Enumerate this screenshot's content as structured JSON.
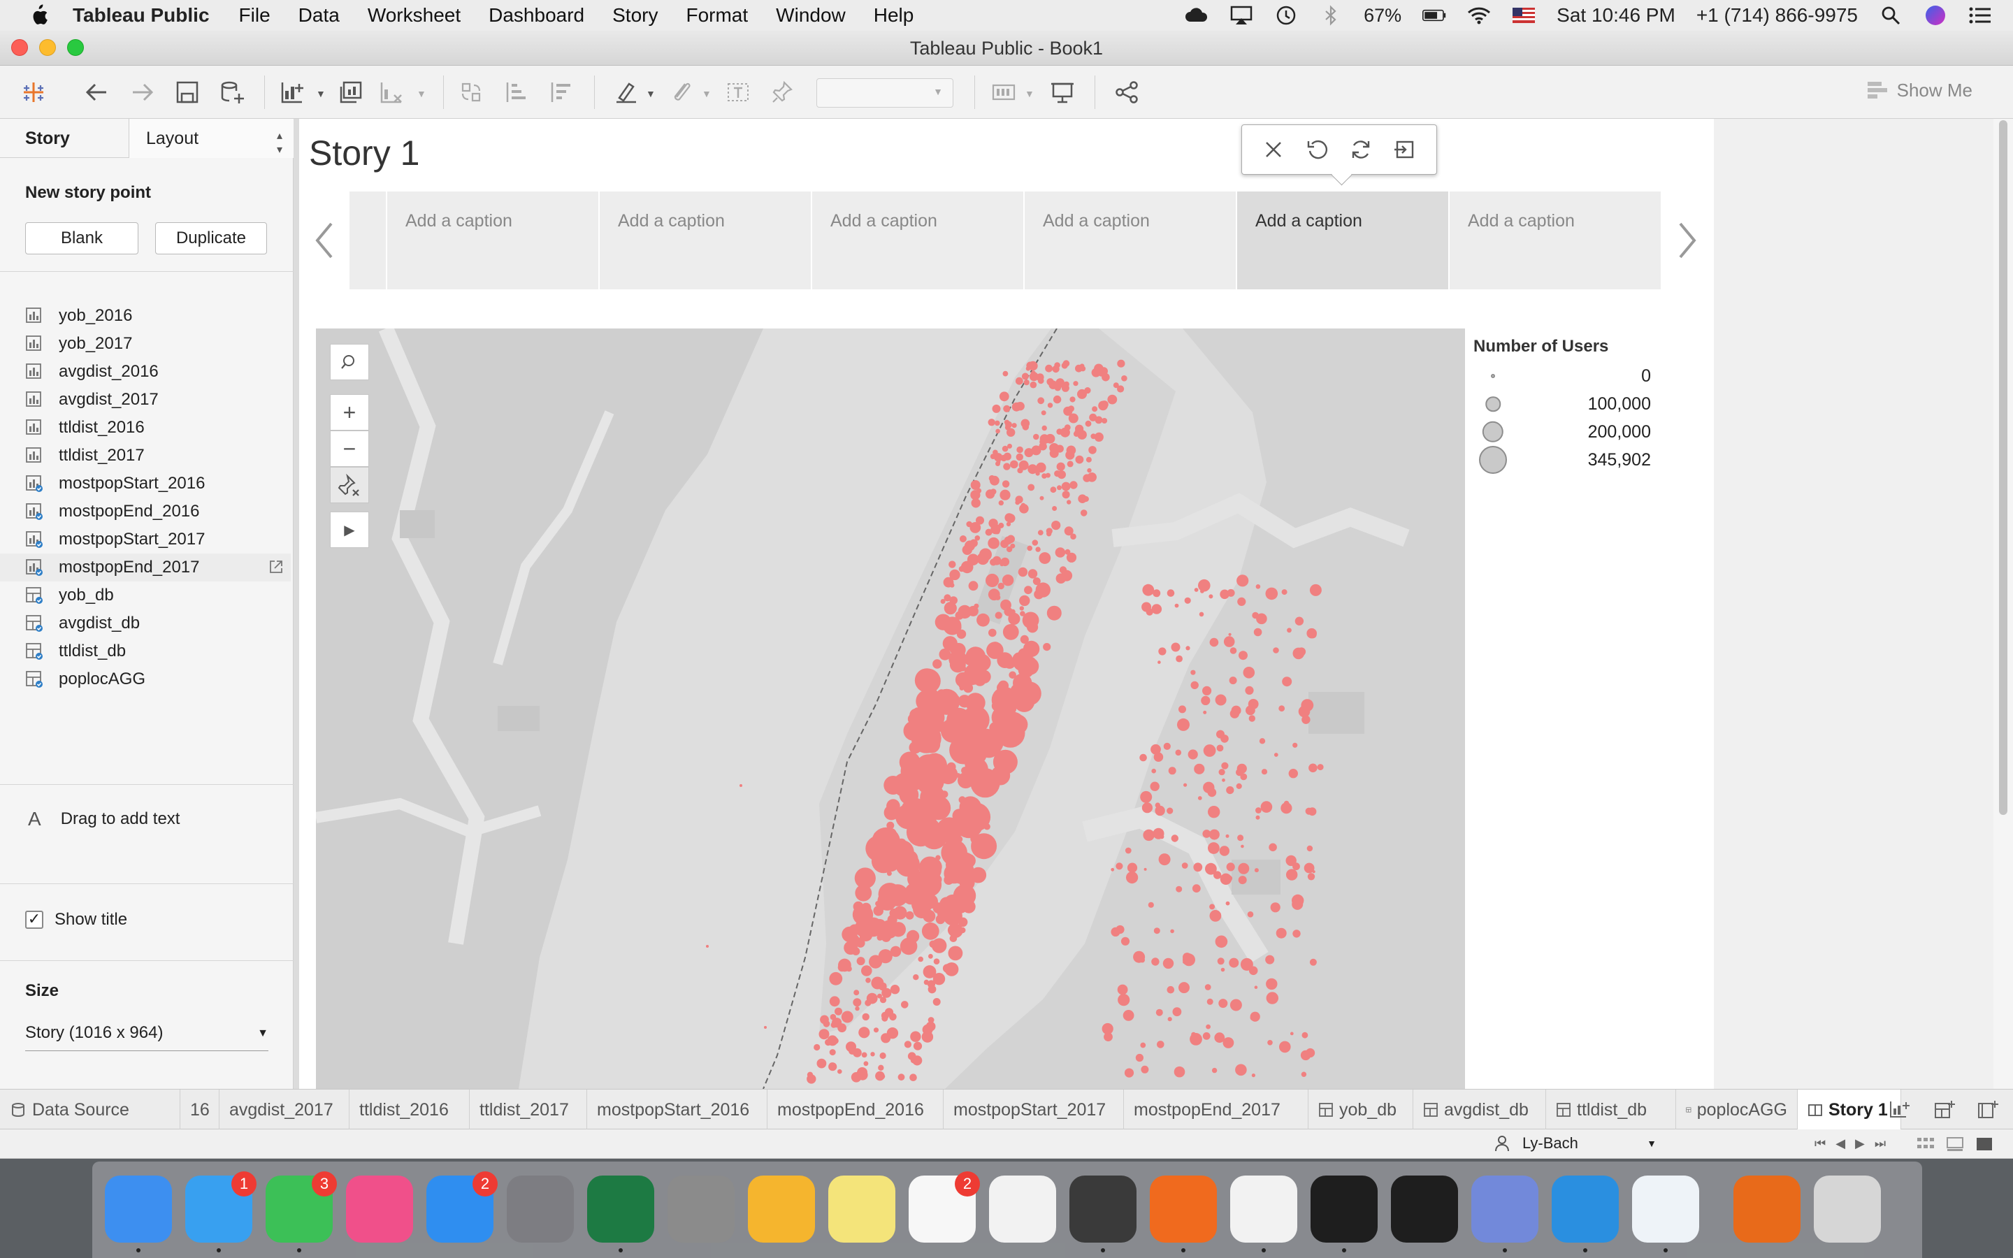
{
  "menubar": {
    "app_name": "Tableau Public",
    "items": [
      "File",
      "Data",
      "Worksheet",
      "Dashboard",
      "Story",
      "Format",
      "Window",
      "Help"
    ],
    "battery": "67%",
    "datetime": "Sat 10:46 PM",
    "phone": "+1 (714) 866-9975"
  },
  "window": {
    "title": "Tableau Public - Book1"
  },
  "toolbar": {
    "show_me": "Show Me"
  },
  "left_panel": {
    "tab_story": "Story",
    "tab_layout": "Layout",
    "new_story_point": "New story point",
    "blank_label": "Blank",
    "duplicate_label": "Duplicate",
    "sheets": [
      {
        "name": "yob_2016",
        "kind": "sheet"
      },
      {
        "name": "yob_2017",
        "kind": "sheet"
      },
      {
        "name": "avgdist_2016",
        "kind": "sheet"
      },
      {
        "name": "avgdist_2017",
        "kind": "sheet"
      },
      {
        "name": "ttldist_2016",
        "kind": "sheet"
      },
      {
        "name": "ttldist_2017",
        "kind": "sheet"
      },
      {
        "name": "mostpopStart_2016",
        "kind": "sheet-used"
      },
      {
        "name": "mostpopEnd_2016",
        "kind": "sheet-used"
      },
      {
        "name": "mostpopStart_2017",
        "kind": "sheet-used"
      },
      {
        "name": "mostpopEnd_2017",
        "kind": "sheet-used"
      },
      {
        "name": "yob_db",
        "kind": "dashboard"
      },
      {
        "name": "avgdist_db",
        "kind": "dashboard"
      },
      {
        "name": "ttldist_db",
        "kind": "dashboard"
      },
      {
        "name": "poplocAGG",
        "kind": "dashboard"
      }
    ],
    "drag_text": "Drag to add text",
    "show_title": "Show title",
    "size_heading": "Size",
    "size_value": "Story (1016 x 964)"
  },
  "story": {
    "title": "Story 1",
    "captions": [
      "Add a caption",
      "Add a caption",
      "Add a caption",
      "Add a caption",
      "Add a caption",
      "Add a caption"
    ],
    "selected_caption": 4
  },
  "legend": {
    "title": "Number of Users",
    "entries": [
      {
        "label": "0",
        "value": 0
      },
      {
        "label": "100,000",
        "value": 100000
      },
      {
        "label": "200,000",
        "value": 200000
      },
      {
        "label": "345,902",
        "value": 345902
      }
    ],
    "mark_color": "#f08080"
  },
  "sheet_tabs": {
    "data_source": "Data Source",
    "tabs": [
      {
        "label": "16",
        "kind": "sheet"
      },
      {
        "label": "avgdist_2017",
        "kind": "sheet"
      },
      {
        "label": "ttldist_2016",
        "kind": "sheet"
      },
      {
        "label": "ttldist_2017",
        "kind": "sheet"
      },
      {
        "label": "mostpopStart_2016",
        "kind": "sheet"
      },
      {
        "label": "mostpopEnd_2016",
        "kind": "sheet"
      },
      {
        "label": "mostpopStart_2017",
        "kind": "sheet"
      },
      {
        "label": "mostpopEnd_2017",
        "kind": "sheet"
      },
      {
        "label": "yob_db",
        "kind": "dashboard"
      },
      {
        "label": "avgdist_db",
        "kind": "dashboard"
      },
      {
        "label": "ttldist_db",
        "kind": "dashboard"
      },
      {
        "label": "poplocAGG",
        "kind": "dashboard"
      },
      {
        "label": "Story 1",
        "kind": "story",
        "active": true
      }
    ]
  },
  "status": {
    "user": "Ly-Bach"
  },
  "dock": {
    "apps": [
      {
        "name": "finder",
        "color": "#3d8ff0",
        "badge": ""
      },
      {
        "name": "messages",
        "color": "#38a0f0",
        "badge": "1"
      },
      {
        "name": "facetime",
        "color": "#3cc057",
        "badge": "3"
      },
      {
        "name": "itunes",
        "color": "#f0508a",
        "badge": ""
      },
      {
        "name": "app-store",
        "color": "#2f8ef0",
        "badge": "2"
      },
      {
        "name": "system-preferences",
        "color": "#7d7d82",
        "badge": ""
      },
      {
        "name": "excel",
        "color": "#1d7a43",
        "badge": ""
      },
      {
        "name": "calculator",
        "color": "#8b8b8b",
        "badge": ""
      },
      {
        "name": "tips",
        "color": "#f5b52e",
        "badge": ""
      },
      {
        "name": "stickies",
        "color": "#f4e47a",
        "badge": ""
      },
      {
        "name": "reminders",
        "color": "#f7f7f7",
        "badge": "2"
      },
      {
        "name": "slack",
        "color": "#f2f2f2",
        "badge": ""
      },
      {
        "name": "sublime-text",
        "color": "#3a3a3a",
        "badge": ""
      },
      {
        "name": "firefox",
        "color": "#f06a1e",
        "badge": ""
      },
      {
        "name": "chrome",
        "color": "#f2f2f2",
        "badge": ""
      },
      {
        "name": "terminal",
        "color": "#1e1e1e",
        "badge": ""
      },
      {
        "name": "activity-monitor",
        "color": "#1e1e1e",
        "badge": ""
      },
      {
        "name": "discord",
        "color": "#7289da",
        "badge": ""
      },
      {
        "name": "markdown",
        "color": "#2a8fe0",
        "badge": ""
      },
      {
        "name": "tableau",
        "color": "#eef3f8",
        "badge": ""
      },
      {
        "name": "books",
        "color": "#e86a1a",
        "badge": ""
      },
      {
        "name": "trash",
        "color": "#d6d6d6",
        "badge": ""
      }
    ]
  }
}
